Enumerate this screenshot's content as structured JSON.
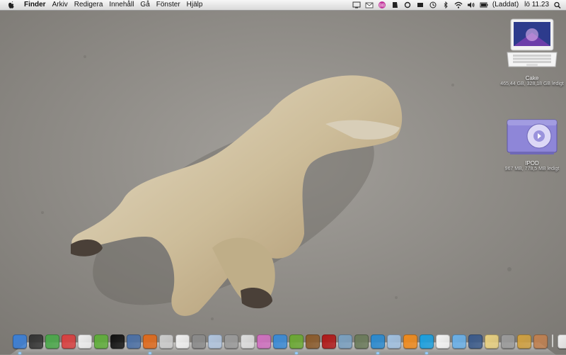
{
  "menubar": {
    "app_name": "Finder",
    "menus": [
      "Arkiv",
      "Redigera",
      "Innehåll",
      "Gå",
      "Fönster",
      "Hjälp"
    ],
    "battery_status": "(Laddat)",
    "clock": "lö 11.23",
    "status_icons": [
      "display-icon",
      "mail-icon",
      "bb-badge-icon",
      "evernote-icon",
      "sync-icon",
      "growl-icon",
      "time-machine-icon",
      "bluetooth-icon",
      "wifi-icon",
      "volume-icon",
      "battery-icon",
      "spotlight-icon"
    ]
  },
  "desktop": {
    "icons": [
      {
        "name": "Cake",
        "info": "465,44 GB, 328,18 GB ledigt",
        "icon": "macbook-icon"
      },
      {
        "name": "IPOD",
        "info": "967 MB, 778,5 MB ledigt",
        "icon": "ipod-shuffle-icon"
      }
    ]
  },
  "dock": {
    "items": [
      {
        "icon": "finder-icon",
        "color": "#3b7fd6",
        "running": true
      },
      {
        "icon": "dashboard-icon",
        "color": "#333333",
        "running": false
      },
      {
        "icon": "mail-stamp-icon",
        "color": "#4aa84a",
        "running": false
      },
      {
        "icon": "iphoto-icon",
        "color": "#d94040",
        "running": false
      },
      {
        "icon": "textedit-icon",
        "color": "#eeeeee",
        "running": false
      },
      {
        "icon": "evernote-icon",
        "color": "#5fae3a",
        "running": false
      },
      {
        "icon": "app-a-icon",
        "color": "#111111",
        "running": false
      },
      {
        "icon": "preview-icon",
        "color": "#4a6fa5",
        "running": false
      },
      {
        "icon": "firefox-icon",
        "color": "#e06a1c",
        "running": true
      },
      {
        "icon": "upload-icon",
        "color": "#cccccc",
        "running": false
      },
      {
        "icon": "flickr-icon",
        "color": "#f0f0f0",
        "running": false
      },
      {
        "icon": "system-prefs-icon",
        "color": "#8a8a8a",
        "running": false
      },
      {
        "icon": "finder-window-icon",
        "color": "#b0c4de",
        "running": false
      },
      {
        "icon": "calculator-icon",
        "color": "#9a9a9a",
        "running": false
      },
      {
        "icon": "dvd-icon",
        "color": "#dddddd",
        "running": false
      },
      {
        "icon": "bookmark-icon",
        "color": "#d070c0",
        "running": false
      },
      {
        "icon": "safari-icon",
        "color": "#3a8ad6",
        "running": false
      },
      {
        "icon": "spotify-icon",
        "color": "#6aa832",
        "running": true
      },
      {
        "icon": "coconut-icon",
        "color": "#8a5a2a",
        "running": false
      },
      {
        "icon": "photo-booth-icon",
        "color": "#b01818",
        "running": false
      },
      {
        "icon": "network-icon",
        "color": "#7aa0c0",
        "running": false
      },
      {
        "icon": "tv-icon",
        "color": "#6a7a5a",
        "running": false
      },
      {
        "icon": "itunes-icon",
        "color": "#2a8ad0",
        "running": true
      },
      {
        "icon": "fish-icon",
        "color": "#a0c0e0",
        "running": false
      },
      {
        "icon": "vlc-icon",
        "color": "#f08a1c",
        "running": false
      },
      {
        "icon": "skype-icon",
        "color": "#1aa0e0",
        "running": true
      },
      {
        "icon": "ical-icon",
        "color": "#f4f4f4",
        "running": false
      },
      {
        "icon": "itunes-music-icon",
        "color": "#6ab0e8",
        "running": false
      },
      {
        "icon": "spaces-icon",
        "color": "#3a5a8a",
        "running": false
      },
      {
        "icon": "stickies-icon",
        "color": "#e8d080",
        "running": false
      },
      {
        "icon": "preferences-icon",
        "color": "#9a9a9a",
        "running": false
      },
      {
        "icon": "iphoto-albums-icon",
        "color": "#d0a040",
        "running": false
      },
      {
        "icon": "photos-icon",
        "color": "#c08050",
        "running": false
      },
      {
        "sep": true
      },
      {
        "icon": "documents-icon",
        "color": "#eeeeee",
        "running": false
      },
      {
        "icon": "trash-icon",
        "color": "#bbbbbb",
        "running": false
      }
    ]
  }
}
